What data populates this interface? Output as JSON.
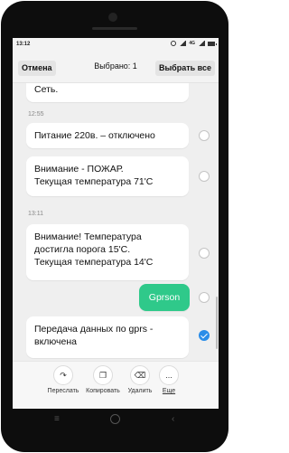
{
  "status": {
    "time": "13:12",
    "network": "4G"
  },
  "header": {
    "cancel": "Отмена",
    "selected": "Выбрано: 1",
    "select_all": "Выбрать все"
  },
  "messages": [
    {
      "text": "Сеть."
    },
    {
      "text": "Питание 220в. – отключено"
    },
    {
      "line1": "Внимание - ПОЖАР.",
      "line2": "Текущая температура  71'С"
    },
    {
      "line1": "Внимание! Температура",
      "line2": "достигла порога 15'С.",
      "line3": "Текущая температура  14'С"
    },
    {
      "text": "Gprson"
    },
    {
      "line1": "Передача данных по gprs -",
      "line2": "включена"
    }
  ],
  "timestamps": [
    "12:55",
    "13:11"
  ],
  "actions": {
    "forward": "Переслать",
    "copy": "Копировать",
    "delete": "Удалить",
    "more": "Еще",
    "more_glyph": "..."
  },
  "colors": {
    "outgoing": "#2fc98a",
    "selection": "#2a8de8"
  }
}
